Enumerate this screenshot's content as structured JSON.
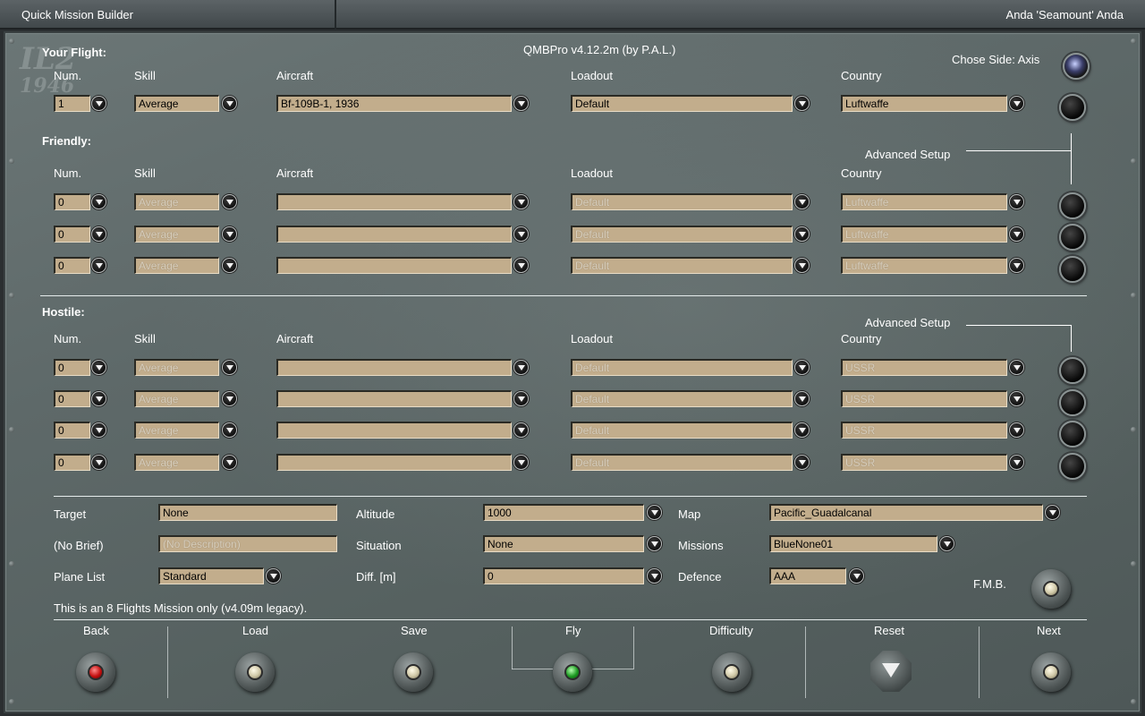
{
  "window": {
    "title": "Quick Mission Builder",
    "user": "Anda 'Seamount' Anda"
  },
  "logo": {
    "text": "IL2",
    "year": "1946"
  },
  "version": "QMBPro v4.12.2m (by P.A.L.)",
  "side": {
    "label": "Chose Side: Axis"
  },
  "columns": {
    "num": "Num.",
    "skill": "Skill",
    "aircraft": "Aircraft",
    "loadout": "Loadout",
    "country": "Country"
  },
  "your_flight": {
    "title": "Your Flight:",
    "row": {
      "num": "1",
      "skill": "Average",
      "aircraft": "Bf-109B-1, 1936",
      "loadout": "Default",
      "country": "Luftwaffe"
    }
  },
  "friendly": {
    "title": "Friendly:",
    "advanced": "Advanced Setup",
    "rows": [
      {
        "num": "0",
        "skill": "Average",
        "aircraft": "",
        "loadout": "Default",
        "country": "Luftwaffe"
      },
      {
        "num": "0",
        "skill": "Average",
        "aircraft": "",
        "loadout": "Default",
        "country": "Luftwaffe"
      },
      {
        "num": "0",
        "skill": "Average",
        "aircraft": "",
        "loadout": "Default",
        "country": "Luftwaffe"
      }
    ]
  },
  "hostile": {
    "title": "Hostile:",
    "advanced": "Advanced Setup",
    "rows": [
      {
        "num": "0",
        "skill": "Average",
        "aircraft": "",
        "loadout": "Default",
        "country": "USSR"
      },
      {
        "num": "0",
        "skill": "Average",
        "aircraft": "",
        "loadout": "Default",
        "country": "USSR"
      },
      {
        "num": "0",
        "skill": "Average",
        "aircraft": "",
        "loadout": "Default",
        "country": "USSR"
      },
      {
        "num": "0",
        "skill": "Average",
        "aircraft": "",
        "loadout": "Default",
        "country": "USSR"
      }
    ]
  },
  "settings": {
    "target": {
      "label": "Target",
      "value": "None"
    },
    "brief": {
      "label": "(No Brief)",
      "value": "(No Description)"
    },
    "plane_list": {
      "label": "Plane List",
      "value": "Standard"
    },
    "altitude": {
      "label": "Altitude",
      "value": "1000"
    },
    "situation": {
      "label": "Situation",
      "value": "None"
    },
    "diff": {
      "label": "Diff. [m]",
      "value": "0"
    },
    "map": {
      "label": "Map",
      "value": "Pacific_Guadalcanal"
    },
    "missions": {
      "label": "Missions",
      "value": "BlueNone01"
    },
    "defence": {
      "label": "Defence",
      "value": "AAA"
    },
    "fmb": {
      "label": "F.M.B."
    }
  },
  "note": "This is an 8 Flights Mission only (v4.09m legacy).",
  "buttons": {
    "back": "Back",
    "load": "Load",
    "save": "Save",
    "fly": "Fly",
    "difficulty": "Difficulty",
    "reset": "Reset",
    "next": "Next"
  }
}
